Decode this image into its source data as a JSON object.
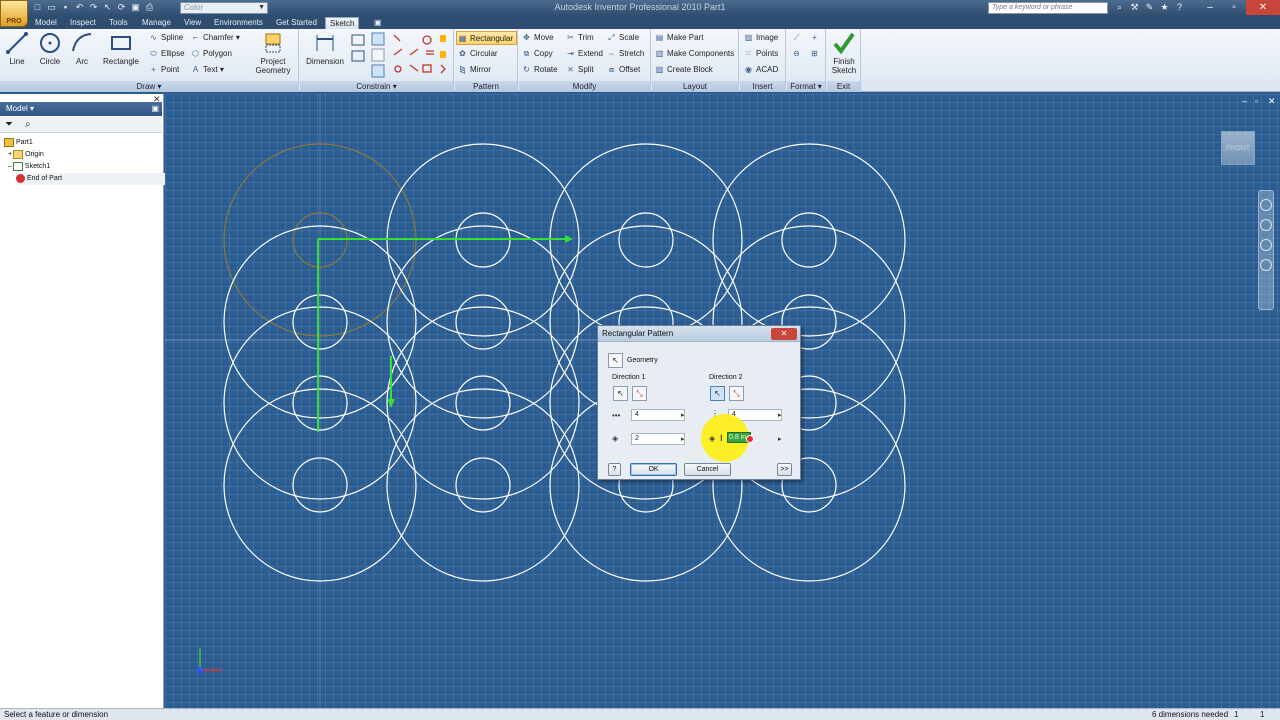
{
  "titlebar": {
    "app_title": "Autodesk Inventor Professional 2010    Part1",
    "color_select": "Color",
    "search_placeholder": "Type a keyword or phrase",
    "app_button": "PRO"
  },
  "tabs": [
    "Model",
    "Inspect",
    "Tools",
    "Manage",
    "View",
    "Environments",
    "Get Started",
    "Sketch"
  ],
  "active_tab": "Sketch",
  "ribbon": {
    "draw": {
      "title": "Draw",
      "line": "Line",
      "circle": "Circle",
      "arc": "Arc",
      "rectangle": "Rectangle",
      "spline": "Spline",
      "ellipse": "Ellipse",
      "point": "Point",
      "chamfer": "Chamfer",
      "polygon": "Polygon",
      "text": "Text",
      "project_geometry_1": "Project",
      "project_geometry_2": "Geometry"
    },
    "constrain": {
      "title": "Constrain",
      "dimension": "Dimension"
    },
    "pattern": {
      "title": "Pattern",
      "rectangular": "Rectangular",
      "circular": "Circular",
      "mirror": "Mirror"
    },
    "modify": {
      "title": "Modify",
      "move": "Move",
      "copy": "Copy",
      "rotate": "Rotate",
      "trim": "Trim",
      "extend": "Extend",
      "split": "Split",
      "scale": "Scale",
      "stretch": "Stretch",
      "offset": "Offset"
    },
    "layout": {
      "title": "Layout",
      "make_part": "Make Part",
      "make_components": "Make Components",
      "create_block": "Create Block"
    },
    "insert": {
      "title": "Insert",
      "image": "Image",
      "points": "Points",
      "acad": "ACAD"
    },
    "format": {
      "title": "Format"
    },
    "exit": {
      "title": "Exit",
      "finish_1": "Finish",
      "finish_2": "Sketch"
    }
  },
  "browser": {
    "header": "Model",
    "tree": [
      "Part1",
      "Origin",
      "Sketch1",
      "End of Part"
    ]
  },
  "viewcube": "FRONT",
  "dialog": {
    "title": "Rectangular Pattern",
    "geometry": "Geometry",
    "direction1": "Direction 1",
    "direction2": "Direction 2",
    "dir1_count": "4",
    "dir1_spacing": "2",
    "dir2_count": "4",
    "dir2_spacing": "0.8 in",
    "ok": "OK",
    "cancel": "Cancel",
    "more": ">>",
    "help": "?"
  },
  "status": {
    "left": "Select a feature or dimension",
    "dims": "6 dimensions needed",
    "n1": "1",
    "n2": "1"
  },
  "colors": {
    "canvas": "#2b5d92",
    "sketch_curve": "#ffffff",
    "axis_green": "#33e033",
    "ghost": "#8a7a3a"
  }
}
